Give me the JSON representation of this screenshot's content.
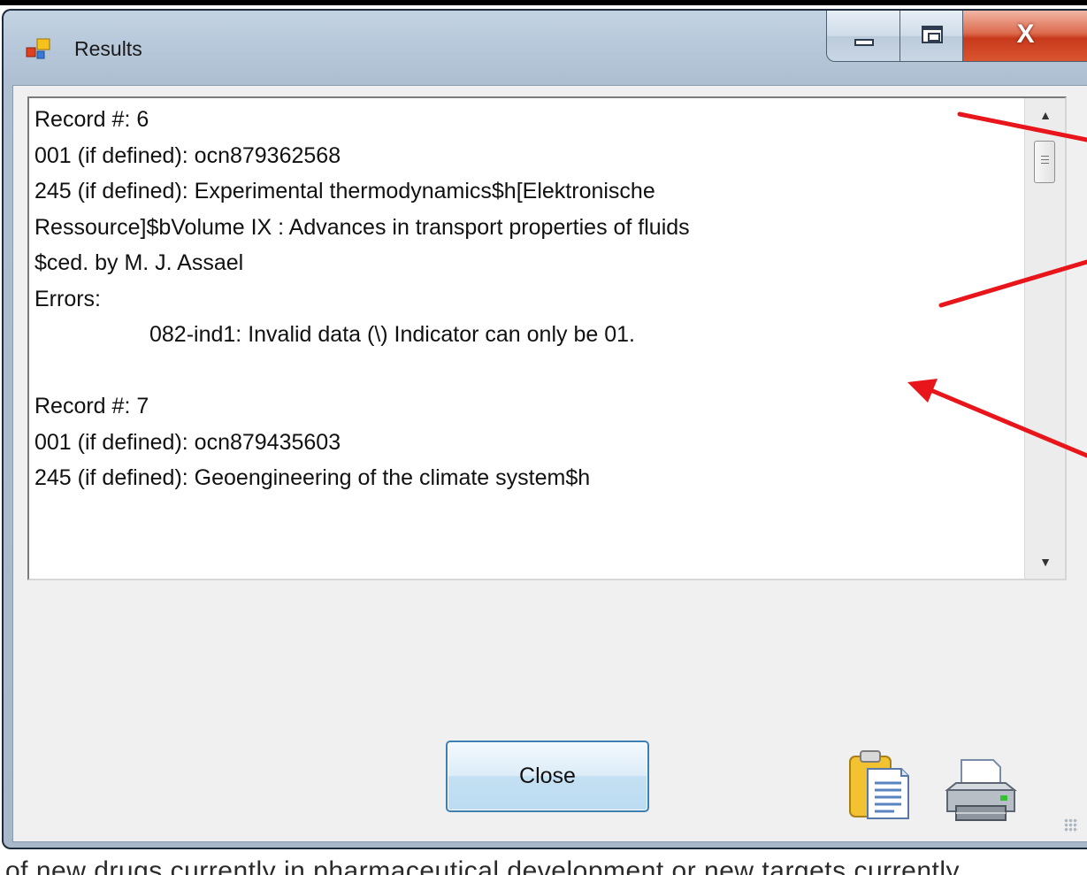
{
  "window": {
    "title": "Results",
    "icon": "application-icon",
    "controls": {
      "minimize": "minimize-icon",
      "maximize": "maximize-icon",
      "close_glyph": "X"
    }
  },
  "results": {
    "lines": [
      {
        "text": "Record #:  6",
        "indent": false
      },
      {
        "text": "001 (if defined):  ocn879362568",
        "indent": false
      },
      {
        "text": "245 (if defined):  Experimental thermodynamics$h[Elektronische",
        "indent": false
      },
      {
        "text": "Ressource]$bVolume IX : Advances in transport properties of fluids",
        "indent": false
      },
      {
        "text": "$ced. by M. J. Assael",
        "indent": false
      },
      {
        "text": "Errors:",
        "indent": false
      },
      {
        "text": "082-ind1:  Invalid data (\\)  Indicator can only be 01.",
        "indent": true
      },
      {
        "text": "",
        "indent": false
      },
      {
        "text": "Record #:  7",
        "indent": false
      },
      {
        "text": "001 (if defined):  ocn879435603",
        "indent": false
      },
      {
        "text": "245 (if defined):  Geoengineering of the climate system$h",
        "indent": false
      }
    ]
  },
  "footer": {
    "close_label": "Close",
    "copy_icon": "clipboard-icon",
    "print_icon": "printer-icon"
  },
  "background_text": "of new drugs currently in pharmaceutical development or new targets currently",
  "colors": {
    "annotation_arrow": "#e8151b",
    "close_control": "#c8391c",
    "button_border": "#3c7fb1"
  }
}
